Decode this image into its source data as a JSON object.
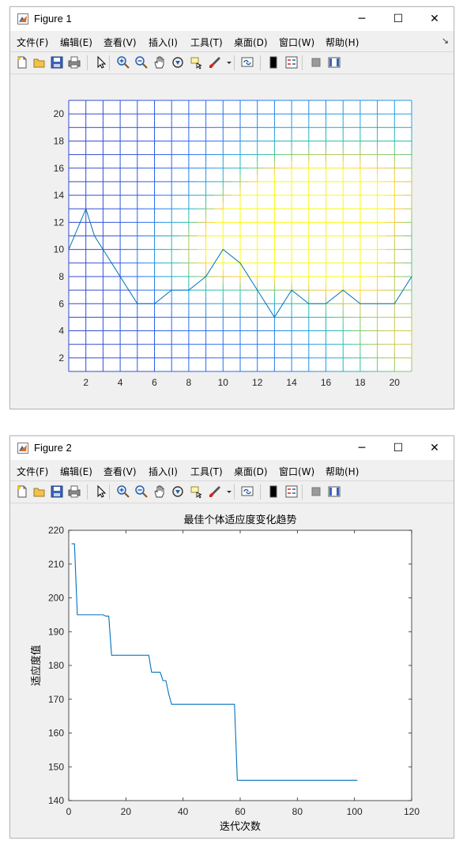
{
  "windows": [
    {
      "title": "Figure 1",
      "menus": [
        "文件(F)",
        "编辑(E)",
        "查看(V)",
        "插入(I)",
        "工具(T)",
        "桌面(D)",
        "窗口(W)",
        "帮助(H)"
      ],
      "controls": {
        "minimize": "─",
        "maximize": "☐",
        "close": "✕"
      }
    },
    {
      "title": "Figure 2",
      "menus": [
        "文件(F)",
        "编辑(E)",
        "查看(V)",
        "插入(I)",
        "工具(T)",
        "桌面(D)",
        "窗口(W)",
        "帮助(H)"
      ],
      "controls": {
        "minimize": "─",
        "maximize": "☐",
        "close": "✕"
      }
    }
  ],
  "toolbar_icons": [
    "new-figure-icon",
    "open-file-icon",
    "save-icon",
    "print-icon",
    "pointer-icon",
    "zoom-in-icon",
    "zoom-out-icon",
    "pan-hand-icon",
    "rotate-3d-icon",
    "data-cursor-icon",
    "brush-icon",
    "dropdown-arrow-icon",
    "link-plot-icon",
    "colorbar-icon",
    "legend-icon",
    "hide-plot-tools-icon",
    "show-plot-tools-icon"
  ],
  "chart_data": [
    {
      "type": "line",
      "subtype": "grid-map-with-path",
      "title": "",
      "xlabel": "",
      "ylabel": "",
      "xlim": [
        1,
        21
      ],
      "ylim": [
        1,
        21
      ],
      "xticks": [
        2,
        4,
        6,
        8,
        10,
        12,
        14,
        16,
        18,
        20
      ],
      "yticks": [
        2,
        4,
        6,
        8,
        10,
        12,
        14,
        16,
        18,
        20
      ],
      "grid_lines": [
        1,
        2,
        3,
        4,
        5,
        6,
        7,
        8,
        9,
        10,
        11,
        12,
        13,
        14,
        15,
        16,
        17,
        18,
        19,
        20,
        21
      ],
      "colormap": "parula",
      "field_hotspots": [
        {
          "x": 15,
          "y": 13,
          "strength": 1.0,
          "spread": 3.0
        },
        {
          "x": 12.5,
          "y": 11,
          "strength": 0.85,
          "spread": 2.4
        },
        {
          "x": 9,
          "y": 9.5,
          "strength": 0.45,
          "spread": 2.2
        },
        {
          "x": 17.5,
          "y": 8.5,
          "strength": 0.5,
          "spread": 2.4
        },
        {
          "x": 20.5,
          "y": 3,
          "strength": 0.45,
          "spread": 2.8
        },
        {
          "x": 20,
          "y": 15,
          "strength": 0.35,
          "spread": 2.5
        }
      ],
      "path_x": [
        1,
        2,
        2.5,
        3,
        4,
        5,
        6,
        7,
        8,
        9,
        10,
        11,
        12,
        13,
        14,
        15,
        16,
        17,
        18,
        19,
        20,
        21
      ],
      "path_y": [
        10,
        13,
        11,
        10,
        8,
        6,
        6,
        7,
        7,
        8,
        10,
        9,
        7,
        5,
        7,
        6,
        6,
        7,
        6,
        6,
        6,
        8
      ],
      "series_color": "#0072bd"
    },
    {
      "type": "line",
      "title": "最佳个体适应度变化趋势",
      "xlabel": "迭代次数",
      "ylabel": "适应度值",
      "xlim": [
        0,
        120
      ],
      "ylim": [
        140,
        220
      ],
      "xticks": [
        0,
        20,
        40,
        60,
        80,
        100,
        120
      ],
      "yticks": [
        140,
        150,
        160,
        170,
        180,
        190,
        200,
        210,
        220
      ],
      "series": [
        {
          "x": [
            1,
            2,
            3,
            4,
            5,
            6,
            7,
            8,
            9,
            10,
            11,
            12,
            13,
            14,
            15,
            16,
            17,
            18,
            19,
            20,
            21,
            22,
            23,
            24,
            25,
            26,
            27,
            28,
            29,
            30,
            31,
            32,
            33,
            34,
            35,
            36,
            37,
            38,
            39,
            40,
            41,
            42,
            43,
            44,
            45,
            46,
            47,
            48,
            49,
            50,
            51,
            52,
            53,
            54,
            55,
            56,
            57,
            58,
            59,
            60,
            61,
            62,
            63,
            64,
            65,
            66,
            67,
            68,
            69,
            70,
            71,
            72,
            73,
            74,
            75,
            76,
            77,
            78,
            79,
            80,
            81,
            82,
            83,
            84,
            85,
            86,
            87,
            88,
            89,
            90,
            91,
            92,
            93,
            94,
            95,
            96,
            97,
            98,
            99,
            100,
            101
          ],
          "values": [
            216,
            216,
            195,
            195,
            195,
            195,
            195,
            195,
            195,
            195,
            195,
            195,
            194.6,
            194.6,
            183,
            183,
            183,
            183,
            183,
            183,
            183,
            183,
            183,
            183,
            183,
            183,
            183,
            183,
            178,
            178,
            178,
            178,
            175.5,
            175.5,
            171.5,
            168.5,
            168.5,
            168.5,
            168.5,
            168.5,
            168.5,
            168.5,
            168.5,
            168.5,
            168.5,
            168.5,
            168.5,
            168.5,
            168.5,
            168.5,
            168.5,
            168.5,
            168.5,
            168.5,
            168.5,
            168.5,
            168.5,
            168.5,
            146,
            146,
            146,
            146,
            146,
            146,
            146,
            146,
            146,
            146,
            146,
            146,
            146,
            146,
            146,
            146,
            146,
            146,
            146,
            146,
            146,
            146,
            146,
            146,
            146,
            146,
            146,
            146,
            146,
            146,
            146,
            146,
            146,
            146,
            146,
            146,
            146,
            146,
            146,
            146,
            146,
            146,
            146
          ]
        }
      ],
      "series_color": "#0072bd"
    }
  ]
}
